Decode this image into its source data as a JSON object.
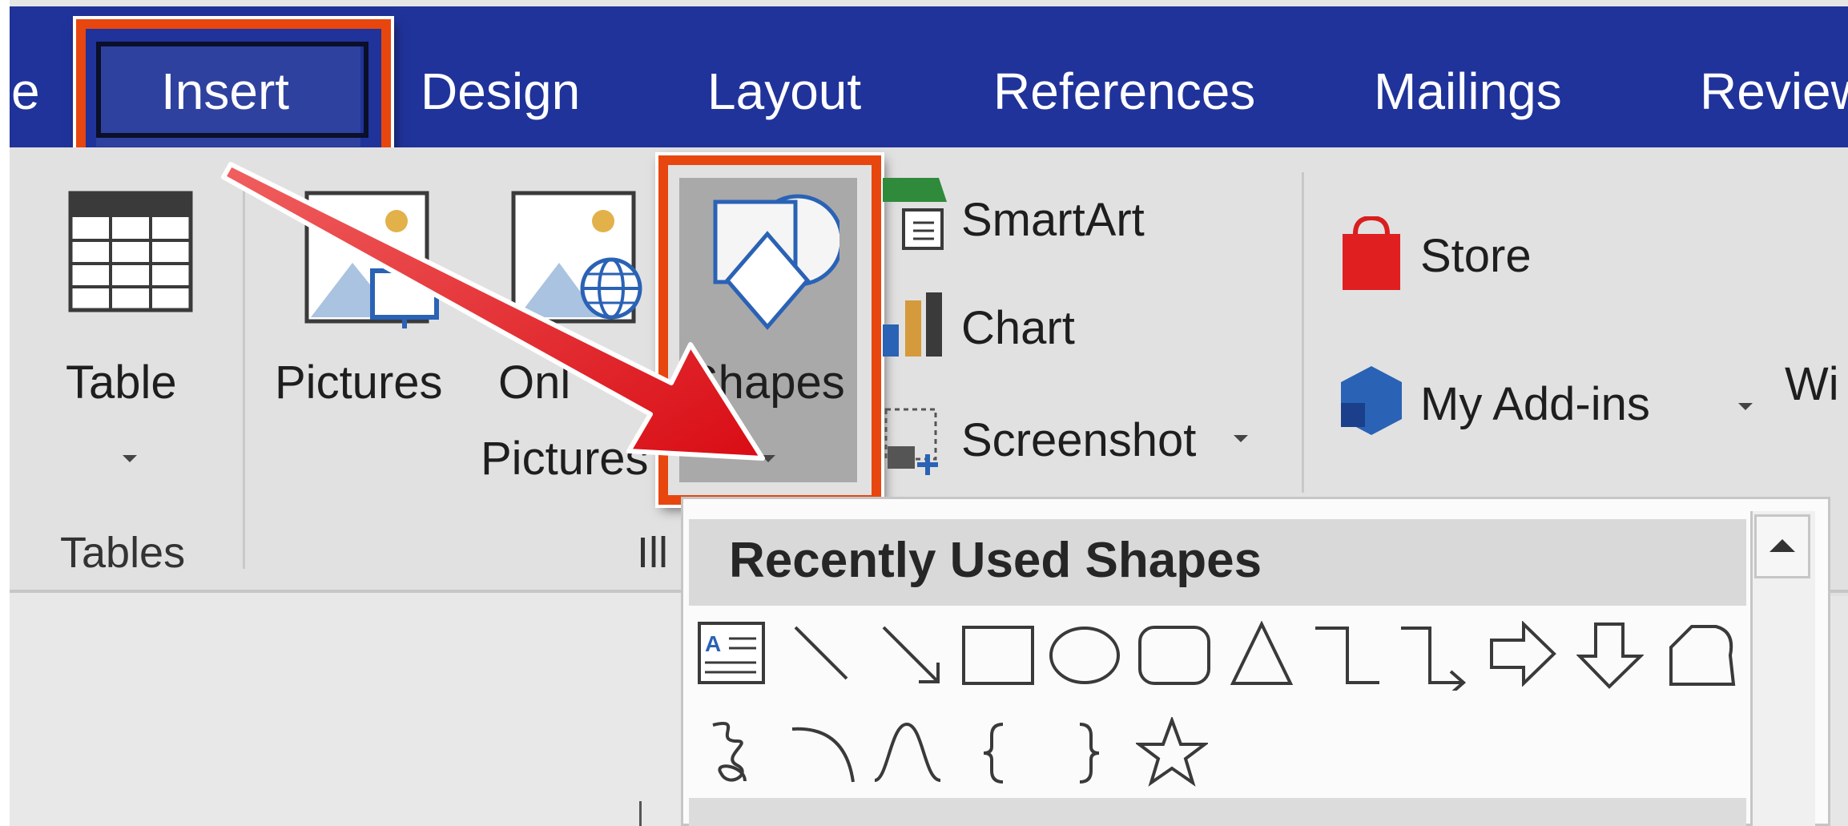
{
  "tabs": [
    {
      "label": "e"
    },
    {
      "label": "Insert",
      "selected": true
    },
    {
      "label": "Design"
    },
    {
      "label": "Layout"
    },
    {
      "label": "References"
    },
    {
      "label": "Mailings"
    },
    {
      "label": "Review"
    }
  ],
  "ribbon": {
    "table_label": "Table",
    "tables_group_label": "Tables",
    "pictures_label": "Pictures",
    "online_pictures_line1": "Onl",
    "online_pictures_line2": "Pictures",
    "shapes_label": "Shapes",
    "illustrations_group_label": "Ill",
    "smartart_label": "SmartArt",
    "chart_label": "Chart",
    "screenshot_label": "Screenshot",
    "store_label": "Store",
    "my_addins_label": "My Add-ins",
    "wi_label": "Wi"
  },
  "shapes_panel": {
    "header": "Recently Used Shapes",
    "row1_icons": [
      "text-box-icon",
      "line-icon",
      "arrow-line-icon",
      "rectangle-icon",
      "oval-icon",
      "rounded-rectangle-icon",
      "triangle-icon",
      "elbow-connector-icon",
      "elbow-arrow-connector-icon",
      "right-arrow-icon",
      "down-arrow-icon",
      "flowchart-shape-icon"
    ],
    "row2_icons": [
      "freeform-scribble-icon",
      "arc-icon",
      "curve-icon",
      "left-brace-icon",
      "right-brace-icon",
      "star-icon"
    ]
  },
  "colors": {
    "tab_bar": "#20339a",
    "highlight": "#e8460f",
    "annotation_arrow": "#e2141b"
  }
}
